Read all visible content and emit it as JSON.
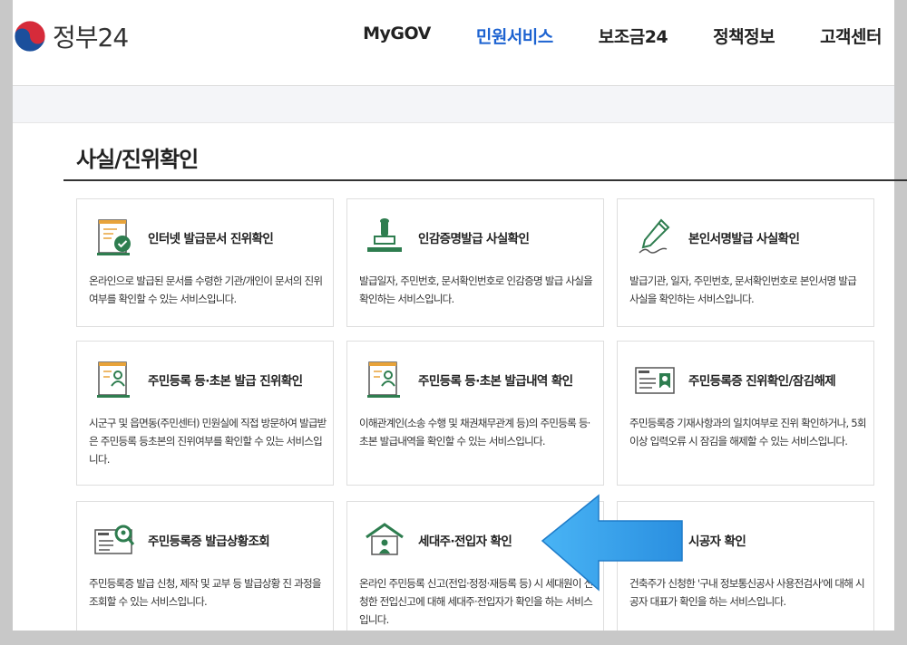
{
  "header": {
    "logo_text": "정부24",
    "nav": [
      {
        "label": "MyGOV",
        "active": false
      },
      {
        "label": "민원서비스",
        "active": true
      },
      {
        "label": "보조금24",
        "active": false
      },
      {
        "label": "정책정보",
        "active": false
      },
      {
        "label": "고객센터",
        "active": false
      }
    ]
  },
  "section": {
    "title": "사실/진위확인"
  },
  "cards": [
    {
      "title": "인터넷 발급문서 진위확인",
      "desc": "온라인으로 발급된 문서를 수령한 기관/개인이 문서의 진위여부를 확인할 수 있는 서비스입니다.",
      "icon": "document-check-icon"
    },
    {
      "title": "인감증명발급 사실확인",
      "desc": "발급일자, 주민번호, 문서확인번호로 인감증명 발급 사실을 확인하는 서비스입니다.",
      "icon": "seal-stamp-icon"
    },
    {
      "title": "본인서명발급 사실확인",
      "desc": "발급기관, 일자, 주민번호, 문서확인번호로 본인서명 발급 사실을 확인하는 서비스입니다.",
      "icon": "pen-signature-icon"
    },
    {
      "title": "주민등록 등·초본 발급 진위확인",
      "desc": "시군구 및 읍면동(주민센터) 민원실에 직접 방문하여 발급받은 주민등록 등초본의 진위여부를 확인할 수 있는 서비스입니다.",
      "icon": "resident-document-icon"
    },
    {
      "title": "주민등록 등·초본 발급내역 확인",
      "desc": "이해관계인(소송 수행 및 채권채무관계 등)의 주민등록 등·초본 발급내역을 확인할 수 있는 서비스입니다.",
      "icon": "resident-document-icon"
    },
    {
      "title": "주민등록증 진위확인/잠김해제",
      "desc": "주민등록증 기재사항과의 일치여부로 진위 확인하거나, 5회 이상 입력오류 시 잠김을 해제할 수 있는 서비스입니다.",
      "icon": "id-card-icon"
    },
    {
      "title": "주민등록증 발급상황조회",
      "desc": "주민등록증 발급 신청, 제작 및 교부 등 발급상황 진 과정을 조회할 수 있는 서비스입니다.",
      "icon": "id-card-search-icon"
    },
    {
      "title": "세대주·전입자 확인",
      "desc": "온라인 주민등록 신고(전입·정정·재등록 등) 시 세대원이 신청한 전입신고에 대해 세대주·전입자가 확인을 하는 서비스입니다.",
      "icon": "house-person-icon"
    },
    {
      "title": "시공자 확인",
      "desc": "건축주가 신청한 '구내 정보통신공사 사용전검사'에 대해 시공자 대표가 확인을 하는 서비스입니다.",
      "icon": "constructor-icon"
    }
  ],
  "colors": {
    "accent": "#1d63d1",
    "icon_green": "#2e7d4f",
    "icon_orange": "#e8a33a",
    "arrow": "#3aa3ee"
  }
}
